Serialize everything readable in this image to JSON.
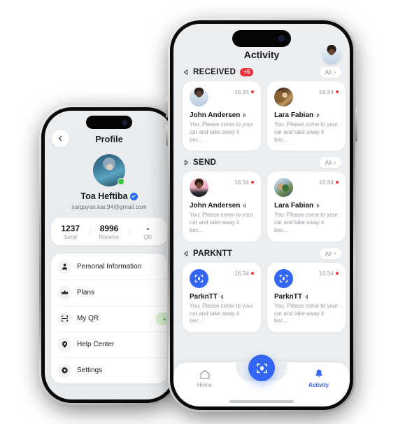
{
  "colors": {
    "accent": "#3366f6",
    "danger": "#f5333f",
    "success": "#2ecb3f",
    "badge_green_bg": "#dff4d6",
    "badge_green_text": "#3aa63a",
    "screen_bg": "#eceef0",
    "card_bg": "#ffffff",
    "text_primary": "#17171b",
    "text_muted": "#9a9da3"
  },
  "profile_phone": {
    "title": "Profile",
    "back_icon": "chevron-left-icon",
    "avatar_icon": "user-avatar",
    "name": "Toa Heftiba",
    "verified_icon": "verified-badge-icon",
    "email": "sargsyan.kar.94@gmail.com",
    "online_status": true,
    "stats": [
      {
        "value": "1237",
        "label": "Send"
      },
      {
        "value": "8996",
        "label": "Receive"
      },
      {
        "value": "-",
        "label": "QR"
      }
    ],
    "menu": [
      {
        "icon": "person-icon",
        "label": "Personal Information",
        "badge": null
      },
      {
        "icon": "crown-icon",
        "label": "Plans",
        "badge": null
      },
      {
        "icon": "qr-scan-icon",
        "label": "My QR",
        "badge": "+ Add"
      },
      {
        "icon": "help-circle-icon",
        "label": "Help Center",
        "badge": null
      },
      {
        "icon": "gear-icon",
        "label": "Settings",
        "badge": null
      }
    ]
  },
  "activity_phone": {
    "title": "Activity",
    "header_avatar_icon": "user-avatar",
    "sections": [
      {
        "id": "received",
        "icon": "receive-arrow-icon",
        "title": "RECEIVED",
        "badge": "+5",
        "all_label": "All",
        "all_chevron_icon": "chevron-right-icon",
        "cards": [
          {
            "avatar": "john-avatar",
            "time": "16:34",
            "unread": true,
            "name": "John Andersen",
            "direction_icon": "send-arrow-icon",
            "message": "You: Please come to your car and take away it bec..."
          },
          {
            "avatar": "lara-avatar",
            "time": "16:34",
            "unread": true,
            "name": "Lara Fabian",
            "direction_icon": "send-arrow-icon",
            "message": "You: Please come to your car and take away it bec..."
          }
        ]
      },
      {
        "id": "send",
        "icon": "send-arrow-icon",
        "title": "SEND",
        "badge": null,
        "all_label": "All",
        "all_chevron_icon": "chevron-right-icon",
        "cards": [
          {
            "avatar": "john-send-avatar",
            "time": "16:34",
            "unread": true,
            "name": "John Andersen",
            "direction_icon": "receive-arrow-icon",
            "message": "You: Please come to your car and take away it bec..."
          },
          {
            "avatar": "lara-send-avatar",
            "time": "16:34",
            "unread": true,
            "name": "Lara Fabian",
            "direction_icon": "send-arrow-icon",
            "message": "You: Please come to your car and take away it bec..."
          }
        ]
      },
      {
        "id": "parkntt",
        "icon": "receive-arrow-icon",
        "title": "PARKNTT",
        "badge": null,
        "all_label": "All",
        "all_chevron_icon": "chevron-right-icon",
        "cards": [
          {
            "avatar": "app-logo",
            "time": "16:34",
            "unread": true,
            "name": "ParknTT",
            "direction_icon": "receive-arrow-icon",
            "message": "You: Please come to your car and take away it bec..."
          },
          {
            "avatar": "app-logo",
            "time": "16:34",
            "unread": true,
            "name": "ParknTT",
            "direction_icon": "receive-arrow-icon",
            "message": "You: Please come to your car and take away it bec..."
          }
        ]
      }
    ],
    "tabbar": {
      "tabs": [
        {
          "icon": "home-icon",
          "label": "Home",
          "active": false
        },
        {
          "icon": "bell-icon",
          "label": "Activity",
          "active": true
        }
      ],
      "fab_icon": "qr-scan-icon"
    }
  }
}
